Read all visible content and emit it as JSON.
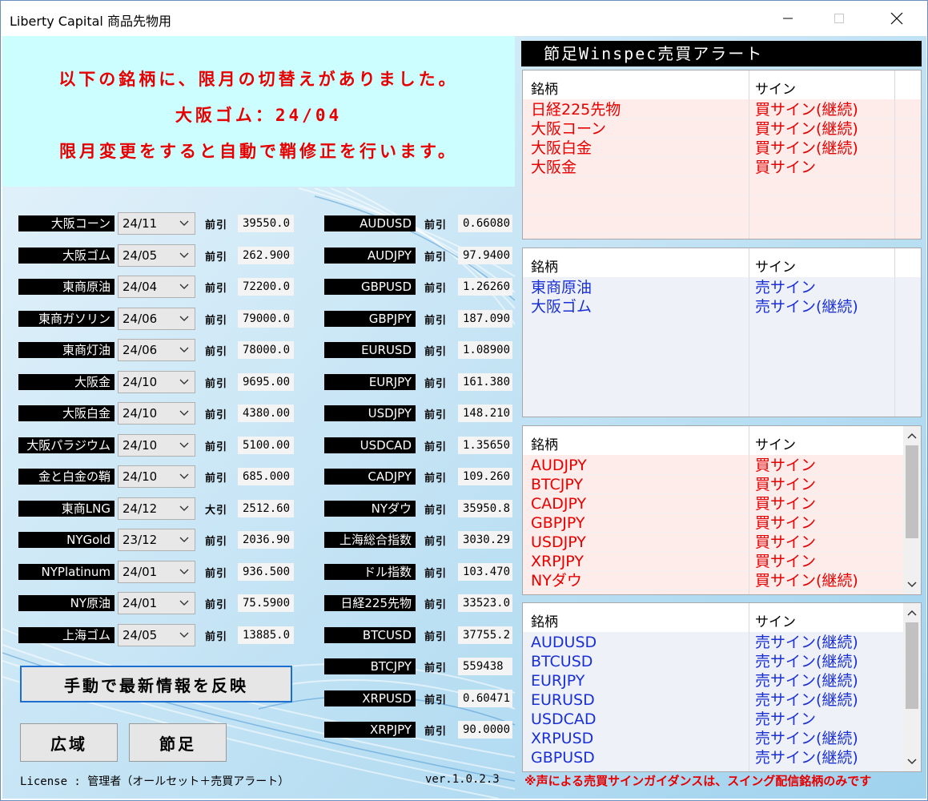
{
  "window": {
    "title": "Liberty Capital 商品先物用"
  },
  "banner": {
    "line1": "以下の銘柄に、限月の切替えがありました。",
    "line2": "大阪ゴム：24/04",
    "line3": "限月変更をすると自動で鞘修正を行います。"
  },
  "commodities": [
    {
      "name": "大阪コーン",
      "month": "24/11",
      "label": "前引",
      "value": "39550.0"
    },
    {
      "name": "大阪ゴム",
      "month": "24/05",
      "label": "前引",
      "value": "262.900"
    },
    {
      "name": "東商原油",
      "month": "24/04",
      "label": "前引",
      "value": "72200.0"
    },
    {
      "name": "東商ガソリン",
      "month": "24/06",
      "label": "前引",
      "value": "79000.0"
    },
    {
      "name": "東商灯油",
      "month": "24/06",
      "label": "前引",
      "value": "78000.0"
    },
    {
      "name": "大阪金",
      "month": "24/10",
      "label": "前引",
      "value": "9695.00"
    },
    {
      "name": "大阪白金",
      "month": "24/10",
      "label": "前引",
      "value": "4380.00"
    },
    {
      "name": "大阪パラジウム",
      "month": "24/10",
      "label": "前引",
      "value": "5100.00"
    },
    {
      "name": "金と白金の鞘",
      "month": "24/10",
      "label": "前引",
      "value": "685.000"
    },
    {
      "name": "東商LNG",
      "month": "24/12",
      "label": "大引",
      "value": "2512.60"
    },
    {
      "name": "NYGold",
      "month": "23/12",
      "label": "前引",
      "value": "2036.90"
    },
    {
      "name": "NYPlatinum",
      "month": "24/01",
      "label": "前引",
      "value": "936.500"
    },
    {
      "name": "NY原油",
      "month": "24/01",
      "label": "前引",
      "value": "75.5900"
    },
    {
      "name": "上海ゴム",
      "month": "24/05",
      "label": "前引",
      "value": "13885.0"
    }
  ],
  "fx": [
    {
      "name": "AUDUSD",
      "label": "前引",
      "value": "0.66080"
    },
    {
      "name": "AUDJPY",
      "label": "前引",
      "value": "97.9400"
    },
    {
      "name": "GBPUSD",
      "label": "前引",
      "value": "1.26260"
    },
    {
      "name": "GBPJPY",
      "label": "前引",
      "value": "187.090"
    },
    {
      "name": "EURUSD",
      "label": "前引",
      "value": "1.08900"
    },
    {
      "name": "EURJPY",
      "label": "前引",
      "value": "161.380"
    },
    {
      "name": "USDJPY",
      "label": "前引",
      "value": "148.210"
    },
    {
      "name": "USDCAD",
      "label": "前引",
      "value": "1.35650"
    },
    {
      "name": "CADJPY",
      "label": "前引",
      "value": "109.260"
    },
    {
      "name": "NYダウ",
      "label": "前引",
      "value": "35950.8"
    },
    {
      "name": "上海総合指数",
      "label": "前引",
      "value": "3030.29"
    },
    {
      "name": "ドル指数",
      "label": "前引",
      "value": "103.470"
    },
    {
      "name": "日経225先物",
      "label": "前引",
      "value": "33523.0"
    },
    {
      "name": "BTCUSD",
      "label": "前引",
      "value": "37755.2"
    },
    {
      "name": "BTCJPY",
      "label": "前引",
      "value": "559438"
    },
    {
      "name": "XRPUSD",
      "label": "前引",
      "value": "0.60471"
    },
    {
      "name": "XRPJPY",
      "label": "前引",
      "value": "90.0000"
    }
  ],
  "buttons": {
    "refresh": "手動で最新情報を反映",
    "wide": "広域",
    "bar": "節足"
  },
  "footer": {
    "license": "License : 管理者（オールセット＋売買アラート）",
    "version": "ver.1.0.2.3",
    "notice": "※声による売買サインガイダンスは、スイング配信銘柄のみです"
  },
  "alerts": {
    "title": "節足Winspec売買アラート",
    "col_name": "銘柄",
    "col_sign": "サイン",
    "panels": [
      {
        "color": "#e60000",
        "bg": "#fdecea",
        "rows": [
          {
            "name": "日経225先物",
            "sign": "買サイン(継続)"
          },
          {
            "name": "大阪コーン",
            "sign": "買サイン(継続)"
          },
          {
            "name": "大阪白金",
            "sign": "買サイン(継続)"
          },
          {
            "name": "大阪金",
            "sign": "買サイン"
          }
        ]
      },
      {
        "color": "#1a2fd6",
        "bg": "#eef2f8",
        "rows": [
          {
            "name": "東商原油",
            "sign": "売サイン"
          },
          {
            "name": "大阪ゴム",
            "sign": "売サイン(継続)"
          }
        ]
      },
      {
        "color": "#e60000",
        "bg": "#fdecea",
        "rows": [
          {
            "name": "AUDJPY",
            "sign": "買サイン"
          },
          {
            "name": "BTCJPY",
            "sign": "買サイン"
          },
          {
            "name": "CADJPY",
            "sign": "買サイン"
          },
          {
            "name": "GBPJPY",
            "sign": "買サイン"
          },
          {
            "name": "USDJPY",
            "sign": "買サイン"
          },
          {
            "name": "XRPJPY",
            "sign": "買サイン"
          },
          {
            "name": "NYダウ",
            "sign": "買サイン(継続)"
          }
        ]
      },
      {
        "color": "#1a2fd6",
        "bg": "#eef2f8",
        "rows": [
          {
            "name": "AUDUSD",
            "sign": "売サイン(継続)"
          },
          {
            "name": "BTCUSD",
            "sign": "売サイン(継続)"
          },
          {
            "name": "EURJPY",
            "sign": "売サイン(継続)"
          },
          {
            "name": "EURUSD",
            "sign": "売サイン(継続)"
          },
          {
            "name": "USDCAD",
            "sign": "売サイン"
          },
          {
            "name": "XRPUSD",
            "sign": "売サイン(継続)"
          },
          {
            "name": "GBPUSD",
            "sign": "売サイン(継続)"
          }
        ]
      }
    ]
  }
}
